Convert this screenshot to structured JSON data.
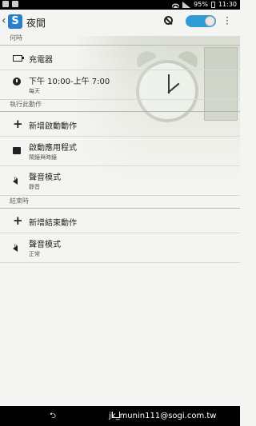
{
  "status_bar": {
    "battery": "95%",
    "time": "11:30"
  },
  "action_bar": {
    "title": "夜間"
  },
  "sections": {
    "when": {
      "header": "何時",
      "items": [
        {
          "icon": "battery-charging-icon",
          "title": "充電器",
          "subtitle": ""
        },
        {
          "icon": "clock-icon",
          "title": "下午 10:00-上午 7:00",
          "subtitle": "每天"
        }
      ]
    },
    "start_actions": {
      "header": "執行此動作",
      "items": [
        {
          "icon": "plus-icon",
          "title": "新增啟動動作",
          "subtitle": ""
        },
        {
          "icon": "launch-app-icon",
          "title": "啟動應用程式",
          "subtitle": "鬧鐘與時鐘"
        },
        {
          "icon": "volume-icon",
          "title": "聲音模式",
          "subtitle": "靜音"
        }
      ]
    },
    "end_actions": {
      "header": "結束時",
      "items": [
        {
          "icon": "plus-icon",
          "title": "新增結束動作",
          "subtitle": ""
        },
        {
          "icon": "volume-icon",
          "title": "聲音模式",
          "subtitle": "正常"
        }
      ]
    }
  },
  "watermark": "jk_munin111@sogi.com.tw"
}
